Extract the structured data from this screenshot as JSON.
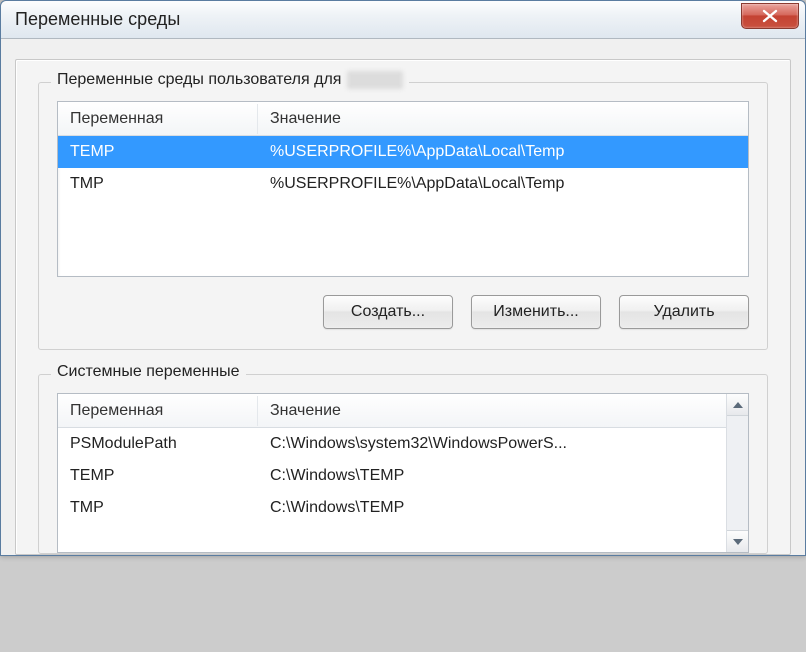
{
  "window": {
    "title": "Переменные среды"
  },
  "user_vars": {
    "legend": "Переменные среды пользователя для",
    "columns": {
      "name": "Переменная",
      "value": "Значение"
    },
    "rows": [
      {
        "name": "TEMP",
        "value": "%USERPROFILE%\\AppData\\Local\\Temp",
        "selected": true
      },
      {
        "name": "TMP",
        "value": "%USERPROFILE%\\AppData\\Local\\Temp",
        "selected": false
      }
    ],
    "buttons": {
      "create": "Создать...",
      "edit": "Изменить...",
      "delete": "Удалить"
    }
  },
  "system_vars": {
    "legend": "Системные переменные",
    "columns": {
      "name": "Переменная",
      "value": "Значение"
    },
    "rows": [
      {
        "name": "PSModulePath",
        "value": "C:\\Windows\\system32\\WindowsPowerS..."
      },
      {
        "name": "TEMP",
        "value": "C:\\Windows\\TEMP"
      },
      {
        "name": "TMP",
        "value": "C:\\Windows\\TEMP"
      }
    ]
  }
}
